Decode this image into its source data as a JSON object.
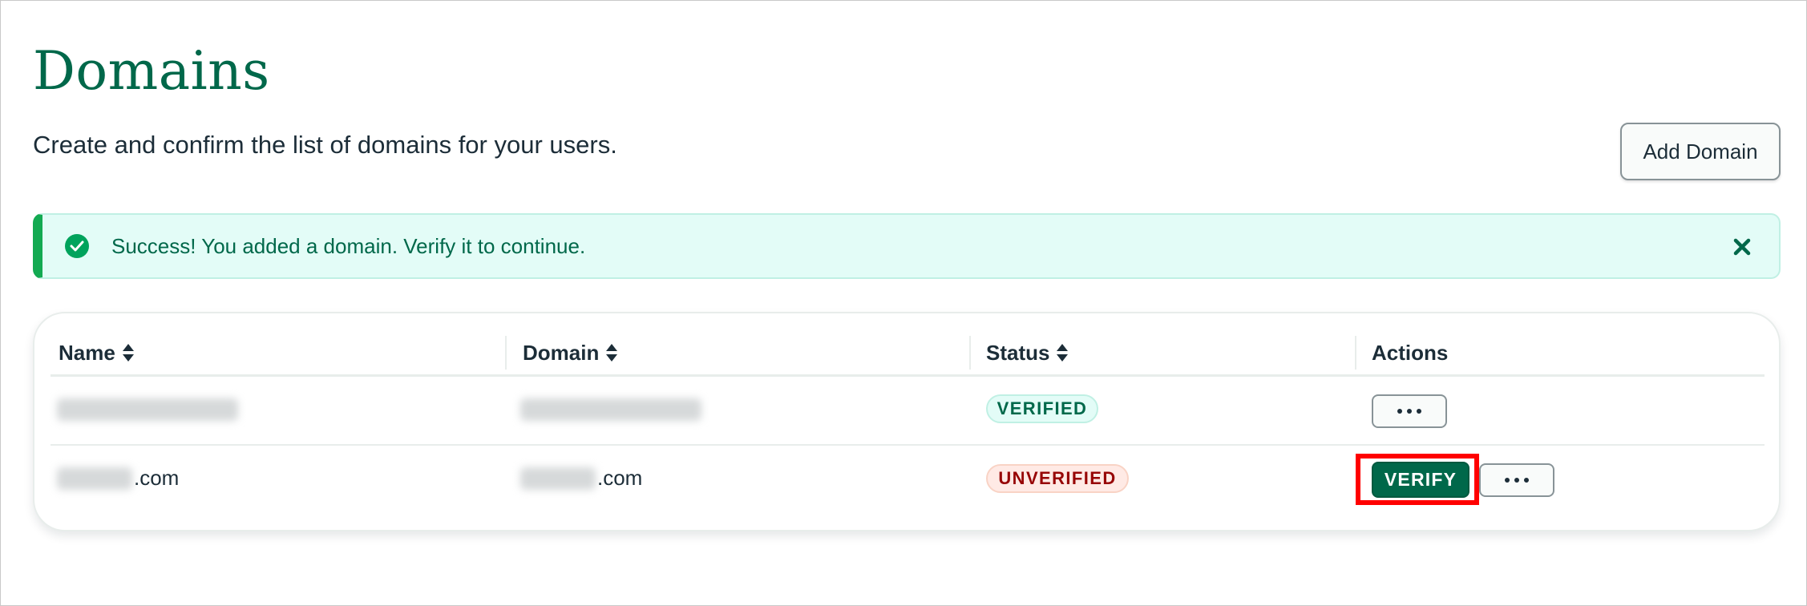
{
  "page": {
    "title": "Domains",
    "subtitle": "Create and confirm the list of domains for your users."
  },
  "toolbar": {
    "add_domain_label": "Add Domain"
  },
  "banner": {
    "message": "Success! You added a domain. Verify it to continue.",
    "icon": "check-circle-icon",
    "close_icon": "close-icon"
  },
  "table": {
    "columns": [
      {
        "label": "Name",
        "sortable": true
      },
      {
        "label": "Domain",
        "sortable": true
      },
      {
        "label": "Status",
        "sortable": true
      },
      {
        "label": "Actions",
        "sortable": false
      }
    ],
    "rows": [
      {
        "name_suffix": "",
        "domain_suffix": "",
        "status": "VERIFIED",
        "actions": [
          "more-options"
        ]
      },
      {
        "name_suffix": ".com",
        "domain_suffix": ".com",
        "status": "UNVERIFIED",
        "actions": [
          "VERIFY",
          "more-options"
        ]
      }
    ]
  },
  "colors": {
    "brand_green": "#00684a",
    "success_banner_bg": "#e3fcf7",
    "verified_text": "#00684a",
    "unverified_text": "#970606",
    "highlight_red": "#ff0000"
  }
}
